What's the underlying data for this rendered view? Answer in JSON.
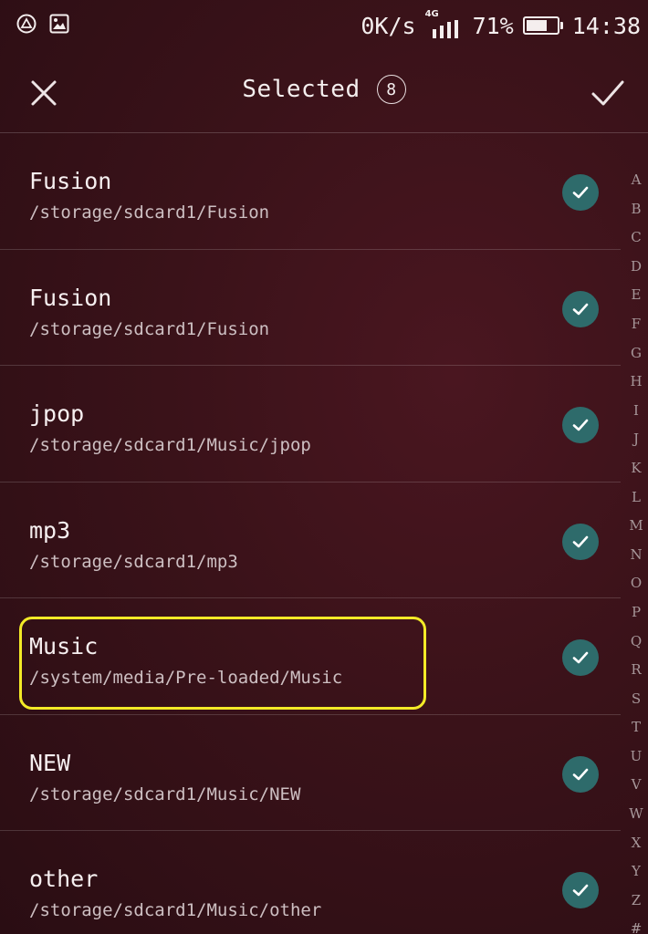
{
  "status_bar": {
    "speed": "0K/s",
    "network": "4G",
    "battery_percent": "71%",
    "battery_level": 0.71,
    "time": "14:38",
    "icons": [
      "alert-triangle-icon",
      "image-icon",
      "signal-icon",
      "battery-icon"
    ]
  },
  "header": {
    "title": "Selected",
    "count": "8",
    "close_icon": "close-icon",
    "confirm_icon": "checkmark-icon"
  },
  "folders": [
    {
      "name": "Fusion",
      "path": "/storage/sdcard1/Fusion",
      "selected": true
    },
    {
      "name": "Fusion",
      "path": "/storage/sdcard1/Fusion",
      "selected": true
    },
    {
      "name": "jpop",
      "path": "/storage/sdcard1/Music/jpop",
      "selected": true
    },
    {
      "name": "mp3",
      "path": "/storage/sdcard1/mp3",
      "selected": true
    },
    {
      "name": "Music",
      "path": "/system/media/Pre-loaded/Music",
      "selected": true,
      "highlighted": true
    },
    {
      "name": "NEW",
      "path": "/storage/sdcard1/Music/NEW",
      "selected": true
    },
    {
      "name": "other",
      "path": "/storage/sdcard1/Music/other",
      "selected": true
    }
  ],
  "colors": {
    "background": "#3a1219",
    "check_fill": "#2e6b6b",
    "highlight_border": "#f3ea27"
  },
  "alphabet_index": [
    "A",
    "B",
    "C",
    "D",
    "E",
    "F",
    "G",
    "H",
    "I",
    "J",
    "K",
    "L",
    "M",
    "N",
    "O",
    "P",
    "Q",
    "R",
    "S",
    "T",
    "U",
    "V",
    "W",
    "X",
    "Y",
    "Z",
    "#"
  ]
}
